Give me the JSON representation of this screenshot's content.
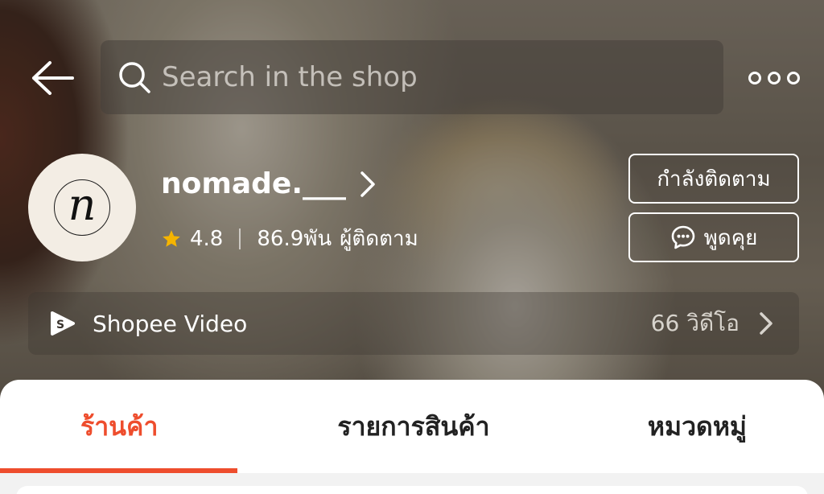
{
  "header": {
    "search_placeholder": "Search in the shop",
    "icons": {
      "back": "arrow-left-icon",
      "search": "search-icon",
      "more": "more-icon"
    }
  },
  "shop": {
    "name": "nomade.___",
    "avatar_letter": "n",
    "rating": "4.8",
    "followers": "86.9พัน",
    "followers_label": "ผู้ติดตาม",
    "follow_button": "กำลังติดตาม",
    "chat_button": "พูดคุย"
  },
  "video": {
    "label": "Shopee Video",
    "count": "66 วิดีโอ"
  },
  "tabs": [
    {
      "label": "ร้านค้า",
      "active": true
    },
    {
      "label": "รายการสินค้า",
      "active": false
    },
    {
      "label": "หมวดหมู่",
      "active": false
    }
  ],
  "colors": {
    "accent": "#ee4d2d",
    "star": "#f5b400"
  }
}
